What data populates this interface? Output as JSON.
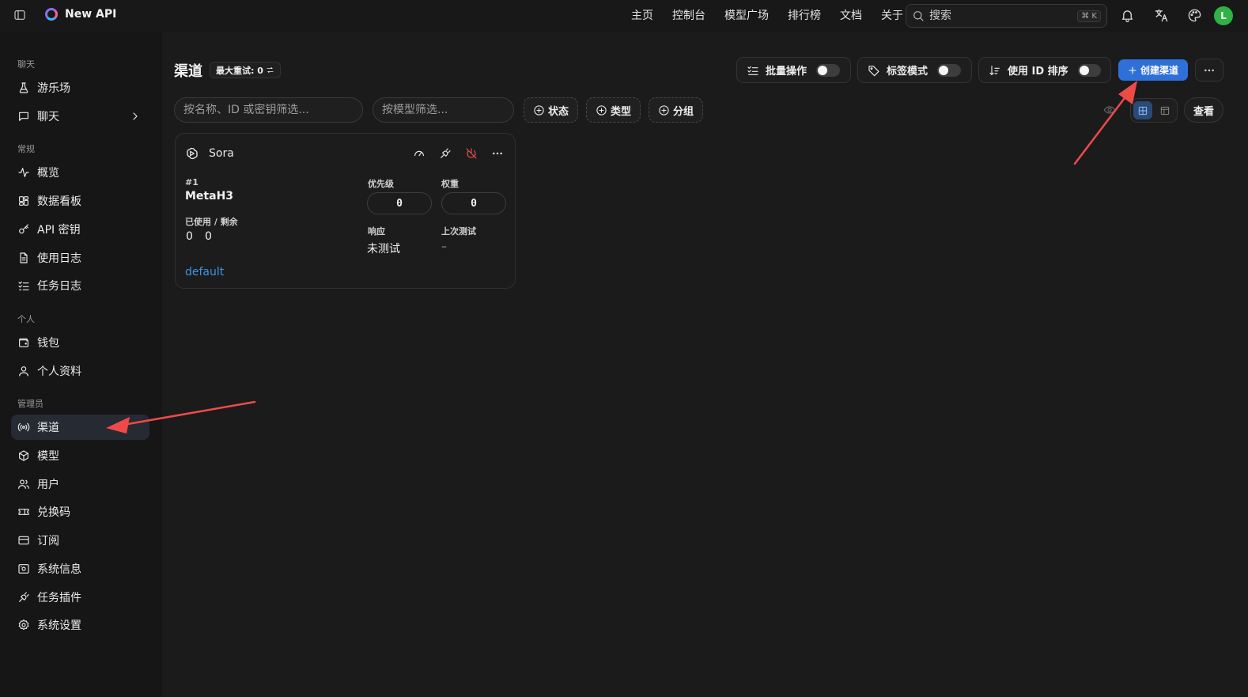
{
  "app": {
    "name": "New API"
  },
  "topnav": [
    "主页",
    "控制台",
    "模型广场",
    "排行榜",
    "文档",
    "关于"
  ],
  "search": {
    "placeholder": "搜索",
    "shortcut": "⌘ K"
  },
  "user": {
    "avatar_letter": "L",
    "avatar_color": "#2fb344"
  },
  "sidebar": {
    "sections": {
      "chat": "聊天",
      "general": "常规",
      "personal": "个人",
      "admin": "管理员"
    },
    "items": [
      {
        "label": "游乐场",
        "icon": "flask-icon"
      },
      {
        "label": "聊天",
        "icon": "message-square-icon",
        "has_submenu": true
      },
      {
        "label": "概览",
        "icon": "activity-icon"
      },
      {
        "label": "数据看板",
        "icon": "dashboard-grid-icon"
      },
      {
        "label": "API 密钥",
        "icon": "key-icon"
      },
      {
        "label": "使用日志",
        "icon": "file-text-icon"
      },
      {
        "label": "任务日志",
        "icon": "list-checks-icon"
      },
      {
        "label": "钱包",
        "icon": "wallet-icon"
      },
      {
        "label": "个人资料",
        "icon": "user-icon"
      },
      {
        "label": "渠道",
        "icon": "radio-icon",
        "active": true
      },
      {
        "label": "模型",
        "icon": "box-icon"
      },
      {
        "label": "用户",
        "icon": "users-icon"
      },
      {
        "label": "兑换码",
        "icon": "ticket-icon"
      },
      {
        "label": "订阅",
        "icon": "credit-card-icon"
      },
      {
        "label": "系统信息",
        "icon": "server-icon"
      },
      {
        "label": "任务插件",
        "icon": "plug-icon"
      },
      {
        "label": "系统设置",
        "icon": "gear-icon"
      }
    ]
  },
  "page": {
    "title": "渠道",
    "retry_badge": "最大重试: 0",
    "toggles": {
      "batch": {
        "label": "批量操作",
        "on": false
      },
      "tag_mode": {
        "label": "标签模式",
        "on": false
      },
      "id_sort": {
        "label": "使用 ID 排序",
        "on": false
      }
    },
    "create_button": "创建渠道",
    "filters": {
      "name_placeholder": "按名称、ID 或密钥筛选...",
      "model_placeholder": "按模型筛选...",
      "chips": [
        "状态",
        "类型",
        "分组"
      ]
    },
    "view_button": "查看",
    "accent_color": "#2f6fd8"
  },
  "channel_card": {
    "name": "Sora",
    "id": "#1",
    "channel_label": "MetaH3",
    "usage_label": "已使用 / 剩余",
    "used": "0",
    "remaining": "0",
    "priority_label": "优先级",
    "priority": "0",
    "weight_label": "权重",
    "weight": "0",
    "response_label": "响应",
    "response": "未测试",
    "last_test_label": "上次测试",
    "last_test": "–",
    "group": "default"
  }
}
